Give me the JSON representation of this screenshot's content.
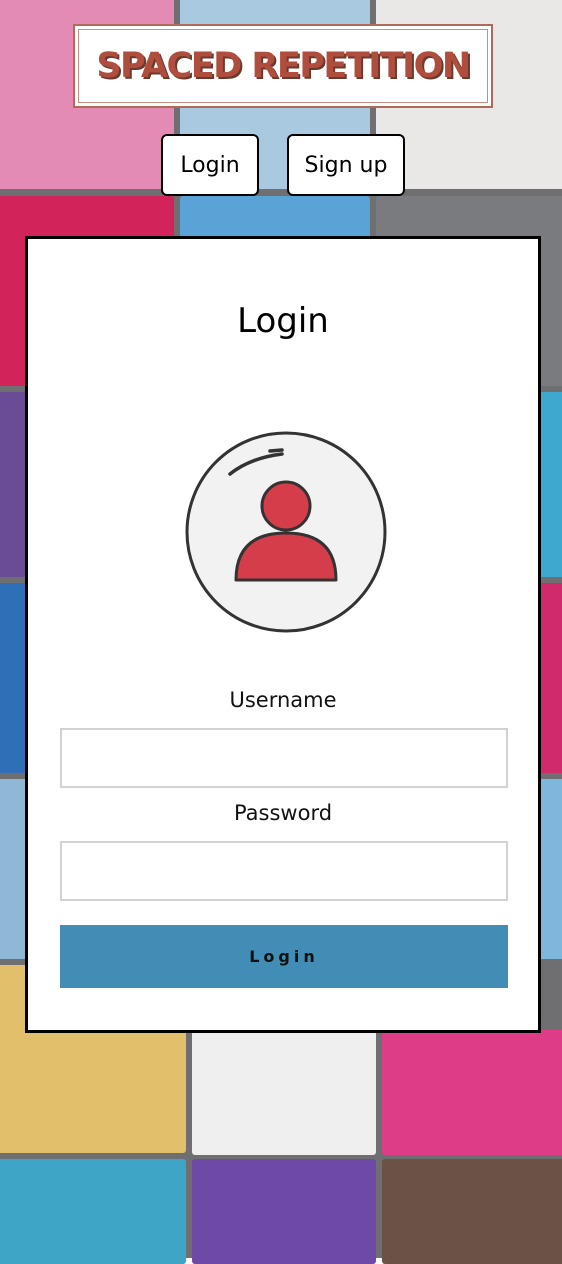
{
  "brand": {
    "title": "SPACED REPETITION"
  },
  "nav": {
    "login_label": "Login",
    "signup_label": "Sign up"
  },
  "form": {
    "title": "Login",
    "username_label": "Username",
    "username_value": "",
    "password_label": "Password",
    "password_value": "",
    "submit_label": "Login"
  },
  "icons": {
    "avatar": "user-avatar-icon"
  },
  "colors": {
    "brand_text": "#b04e3d",
    "submit_button": "#428db5",
    "avatar_accent": "#d63d4b",
    "avatar_circle": "#f2f2f2"
  }
}
